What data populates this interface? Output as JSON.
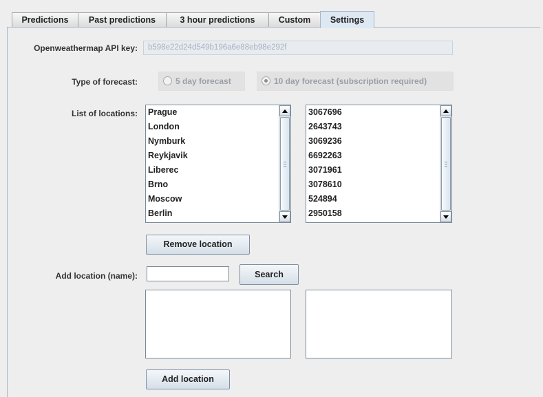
{
  "tabs": [
    {
      "label": "Predictions",
      "active": false
    },
    {
      "label": "Past predictions",
      "active": false
    },
    {
      "label": "3 hour predictions",
      "active": false
    },
    {
      "label": "Custom",
      "active": false
    },
    {
      "label": "Settings",
      "active": true
    }
  ],
  "settings": {
    "api_key_label": "Openweathermap API key:",
    "api_key_value": "b598e22d24d549b196a6e88eb98e292f",
    "forecast_label": "Type of forecast:",
    "forecast_options": [
      {
        "label": "5 day forecast",
        "selected": false,
        "enabled": false
      },
      {
        "label": "10 day forecast (subscription required)",
        "selected": true,
        "enabled": false
      }
    ],
    "locations_label": "List of locations:",
    "location_names": [
      "Prague",
      "London",
      "Nymburk",
      "Reykjavik",
      "Liberec",
      "Brno",
      "Moscow",
      "Berlin"
    ],
    "location_ids": [
      "3067696",
      "2643743",
      "3069236",
      "6692263",
      "3071961",
      "3078610",
      "524894",
      "2950158"
    ],
    "remove_button": "Remove location",
    "add_label": "Add location (name):",
    "add_input_value": "",
    "search_button": "Search",
    "add_button": "Add location"
  }
}
